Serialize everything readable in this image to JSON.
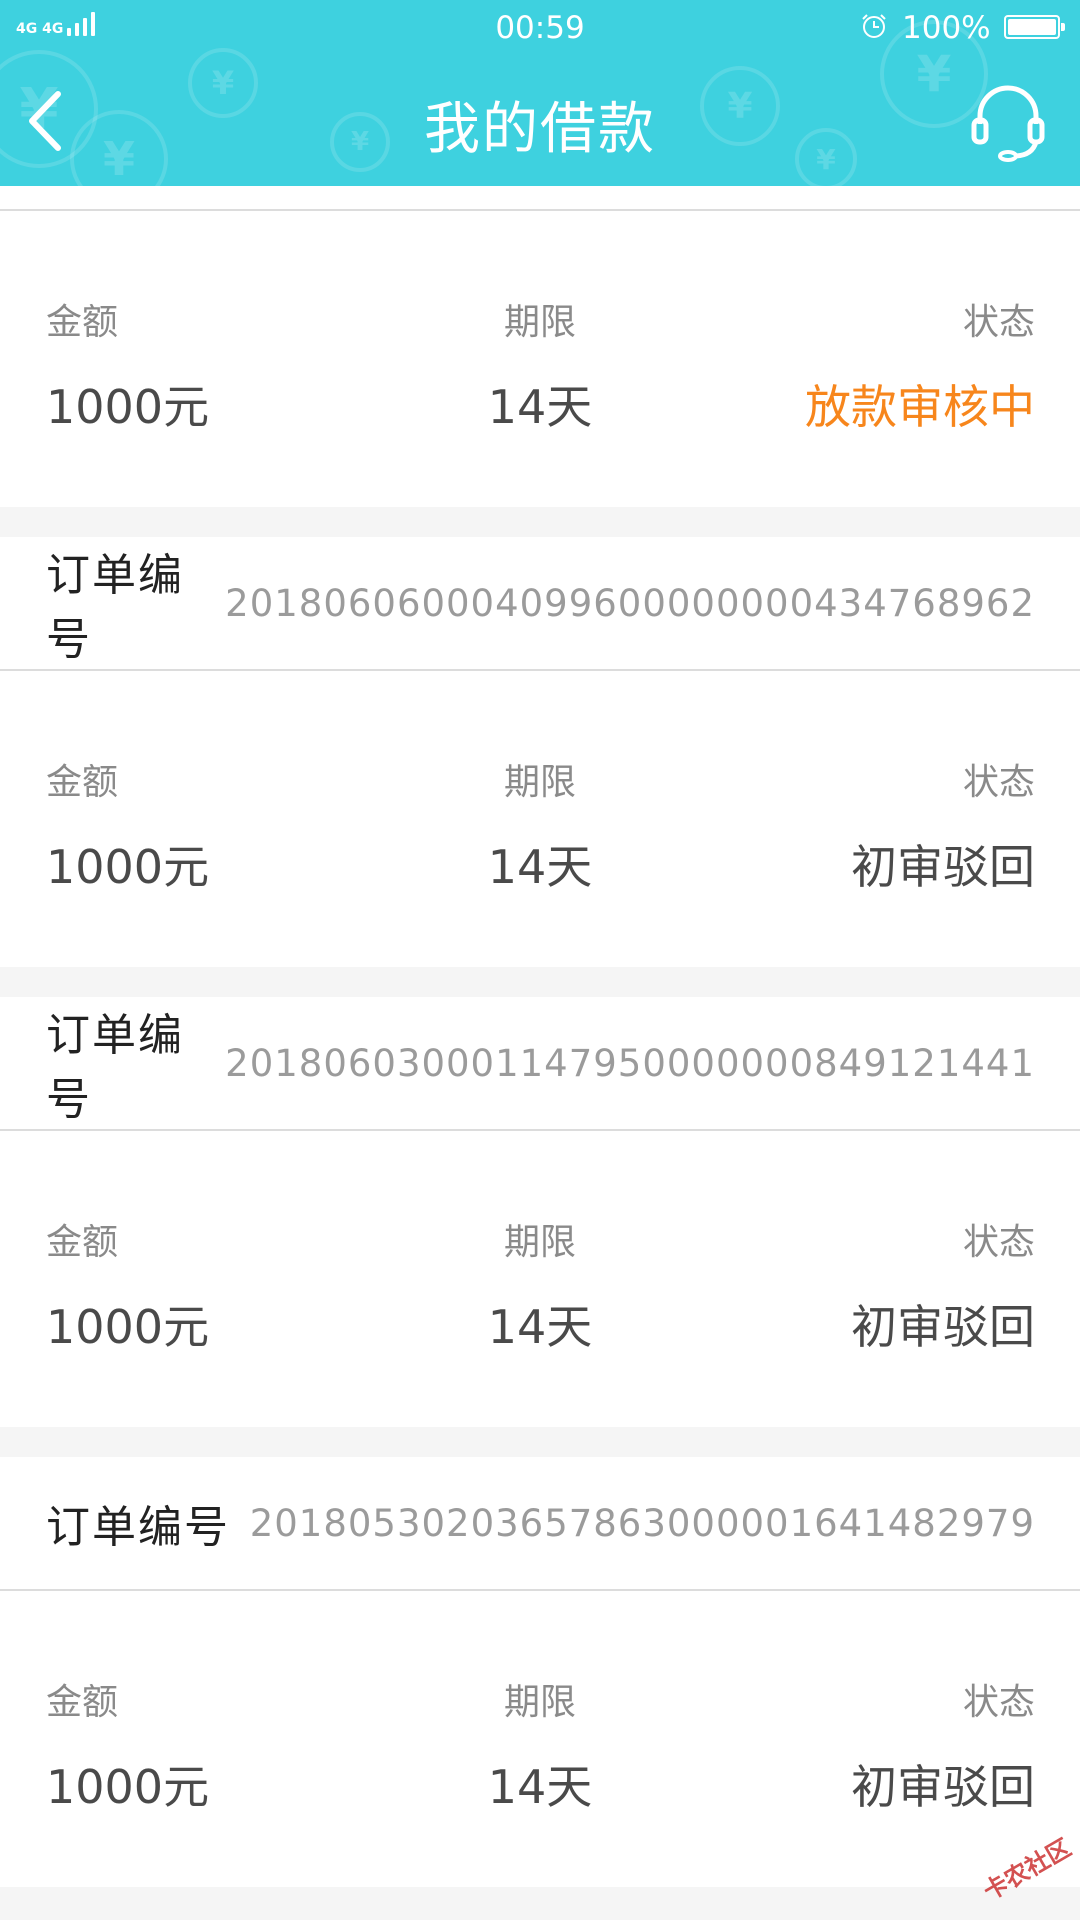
{
  "status_bar": {
    "network": "4G 4G",
    "time": "00:59",
    "battery_pct": "100%"
  },
  "header": {
    "title": "我的借款",
    "background_color": "#3ed1df",
    "coin_symbol": "¥",
    "icons": [
      "back-arrow-icon",
      "customer-service-headset-icon",
      "alarm-clock-icon"
    ]
  },
  "loans": [
    {
      "order_label": null,
      "order_number": null,
      "amount_label": "金额",
      "amount": "1000元",
      "term_label": "期限",
      "term": "14天",
      "status_label": "状态",
      "status": "放款审核中",
      "status_color": "#f7861c"
    },
    {
      "order_label": "订单编号",
      "order_number": "201806060004099600000000434768962",
      "amount_label": "金额",
      "amount": "1000元",
      "term_label": "期限",
      "term": "14天",
      "status_label": "状态",
      "status": "初审驳回"
    },
    {
      "order_label": "订单编号",
      "order_number": "201806030001147950000000849121441",
      "amount_label": "金额",
      "amount": "1000元",
      "term_label": "期限",
      "term": "14天",
      "status_label": "状态",
      "status": "初审驳回"
    },
    {
      "order_label": "订单编号",
      "order_number": "20180530203657863000001641482979",
      "amount_label": "金额",
      "amount": "1000元",
      "term_label": "期限",
      "term": "14天",
      "status_label": "状态",
      "status": "初审驳回"
    }
  ],
  "watermark": "卡农社区"
}
